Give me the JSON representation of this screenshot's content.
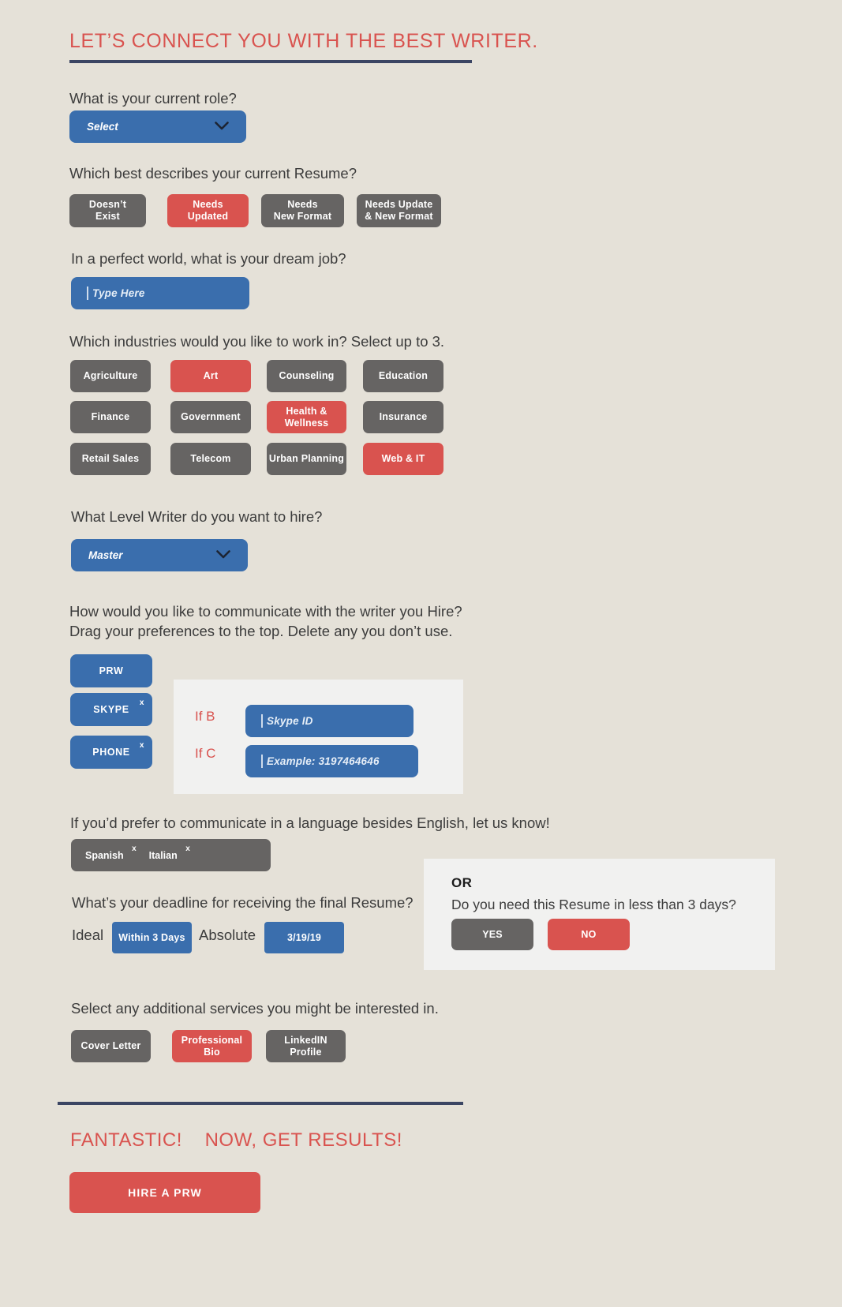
{
  "header": {
    "title": "LET’S CONNECT YOU WITH THE BEST WRITER."
  },
  "colors": {
    "background": "#e5e1d8",
    "accent_red": "#d9534f",
    "accent_blue": "#3a6ead",
    "grey": "#666463",
    "navy_rule": "#3b4563",
    "panel": "#f1f1f0"
  },
  "role": {
    "question": "What is your current role?",
    "select_value": "Select",
    "chevron": "chevron-down-icon"
  },
  "resume_state": {
    "question": "Which best describes your current Resume?",
    "options": [
      {
        "label": "Doesn’t\nExist",
        "selected": false
      },
      {
        "label": "Needs\nUpdated",
        "selected": true
      },
      {
        "label": "Needs\nNew Format",
        "selected": false
      },
      {
        "label": "Needs Update\n& New Format",
        "selected": false
      }
    ]
  },
  "dream_job": {
    "question": "In a perfect world, what is your dream job?",
    "placeholder": "Type Here",
    "value": ""
  },
  "industries": {
    "question": "Which industries would you like to work in? Select up to 3.",
    "options": [
      {
        "label": "Agriculture",
        "selected": false
      },
      {
        "label": "Art",
        "selected": true
      },
      {
        "label": "Counseling",
        "selected": false
      },
      {
        "label": "Education",
        "selected": false
      },
      {
        "label": "Finance",
        "selected": false
      },
      {
        "label": "Government",
        "selected": false
      },
      {
        "label": "Health &\nWellness",
        "selected": true
      },
      {
        "label": "Insurance",
        "selected": false
      },
      {
        "label": "Retail Sales",
        "selected": false
      },
      {
        "label": "Telecom",
        "selected": false
      },
      {
        "label": "Urban Planning",
        "selected": false
      },
      {
        "label": "Web & IT",
        "selected": true
      }
    ]
  },
  "writer_level": {
    "question": "What Level Writer do you want to hire?",
    "select_value": "Master",
    "chevron": "chevron-down-icon"
  },
  "communication": {
    "question": "How would you like to communicate with the writer you Hire?\nDrag your preferences to the top. Delete any you don’t use.",
    "items": [
      {
        "label": "PRW",
        "removable": false,
        "remove_label": ""
      },
      {
        "label": "SKYPE",
        "removable": true,
        "remove_label": "x"
      },
      {
        "label": "PHONE",
        "removable": true,
        "remove_label": "x"
      }
    ],
    "conditionals": [
      {
        "tag": "If B",
        "placeholder": "Skype ID",
        "value": ""
      },
      {
        "tag": "If C",
        "placeholder": "Example: 3197464646",
        "value": ""
      }
    ]
  },
  "language": {
    "question": "If you’d prefer to communicate in a language besides English, let us know!",
    "tags": [
      {
        "label": "Spanish",
        "remove_label": "x"
      },
      {
        "label": "Italian",
        "remove_label": "x"
      }
    ]
  },
  "deadline": {
    "question": "What’s your deadline for receiving the final Resume?",
    "ideal_label": "Ideal",
    "ideal_value": "Within 3 Days",
    "absolute_label": "Absolute",
    "absolute_value": "3/19/19"
  },
  "rush_panel": {
    "or_label": "OR",
    "question": "Do you need this Resume in less than 3 days?",
    "yes_label": "YES",
    "no_label": "NO",
    "yes_selected": false,
    "no_selected": true
  },
  "additional_services": {
    "question": "Select any additional services you might be interested in.",
    "options": [
      {
        "label": "Cover Letter",
        "selected": false
      },
      {
        "label": "Professional\nBio",
        "selected": true
      },
      {
        "label": "LinkedIN\nProfile",
        "selected": false
      }
    ]
  },
  "footer": {
    "title": "FANTASTIC!    NOW, GET RESULTS!",
    "cta_label": "HIRE A PRW"
  }
}
